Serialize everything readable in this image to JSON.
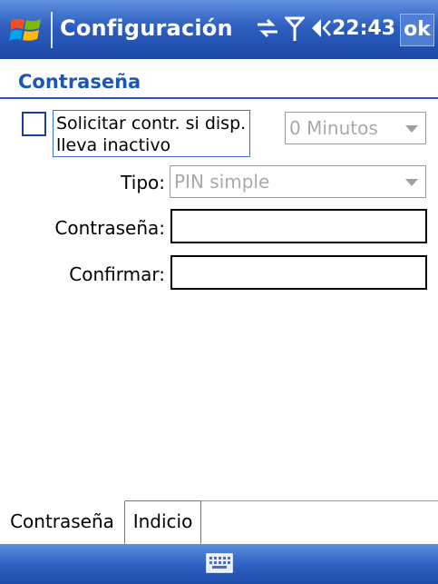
{
  "titlebar": {
    "title": "Configuración",
    "clock": "22:43",
    "ok_label": "ok",
    "icons": [
      "windows-start-icon",
      "connectivity-icon",
      "signal-icon",
      "volume-icon"
    ]
  },
  "page": {
    "heading": "Contraseña"
  },
  "lock": {
    "checkbox_label": "Solicitar contr. si disp. lleva inactivo",
    "checked": false,
    "timeout_value": "0 Minutos",
    "type_label": "Tipo:",
    "type_value": "PIN simple",
    "password_label": "Contraseña:",
    "password_value": "",
    "confirm_label": "Confirmar:",
    "confirm_value": ""
  },
  "tabs": [
    {
      "label": "Contraseña",
      "active": true
    },
    {
      "label": "Indicio",
      "active": false
    }
  ],
  "menubar": {
    "icons": [
      "keyboard-icon"
    ]
  },
  "colors": {
    "titlebar_blue": "#2d5fc0",
    "heading_blue": "#1d56b6",
    "disabled_text": "#a9a9a9"
  }
}
